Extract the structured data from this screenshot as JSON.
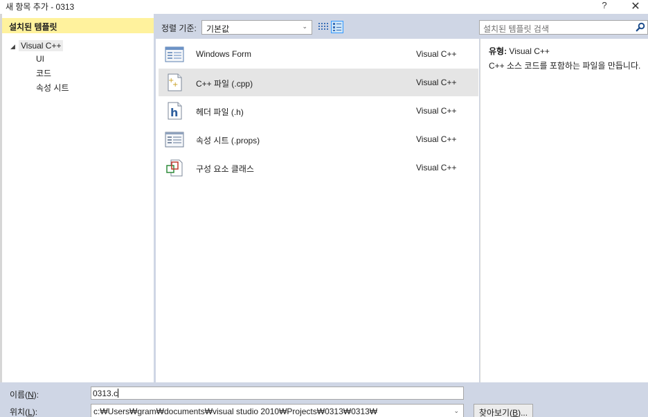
{
  "window": {
    "title": "새 항목 추가 - 0313",
    "help": "?",
    "close": "✕"
  },
  "left": {
    "header": "설치된 템플릿",
    "tree": {
      "root": "Visual C++",
      "children": [
        "UI",
        "코드",
        "속성 시트"
      ]
    }
  },
  "toolbar": {
    "sort_label": "정렬 기준:",
    "sort_value": "기본값",
    "chevron": "⌄"
  },
  "search": {
    "placeholder": "설치된 템플릿 검색"
  },
  "templates": [
    {
      "name": "Windows Form",
      "lang": "Visual C++",
      "icon": "form-icon"
    },
    {
      "name": "C++ 파일 (.cpp)",
      "lang": "Visual C++",
      "icon": "cpp-file-icon",
      "selected": true
    },
    {
      "name": "헤더 파일 (.h)",
      "lang": "Visual C++",
      "icon": "header-file-icon"
    },
    {
      "name": "속성 시트 (.props)",
      "lang": "Visual C++",
      "icon": "property-sheet-icon"
    },
    {
      "name": "구성 요소 클래스",
      "lang": "Visual C++",
      "icon": "component-class-icon"
    }
  ],
  "details": {
    "type_label": "유형:",
    "type_value": "Visual C++",
    "description": "C++ 소스 코드를 포함하는 파일을 만듭니다."
  },
  "bottom": {
    "name_label_pre": "이름(",
    "name_label_key": "N",
    "name_label_post": "):",
    "name_value": "0313.c",
    "location_label_pre": "위치(",
    "location_label_key": "L",
    "location_label_post": "):",
    "location_value": "c:₩Users₩gram₩documents₩visual studio 2010₩Projects₩0313₩0313₩",
    "browse_pre": "찾아보기(",
    "browse_key": "B",
    "browse_post": ")..."
  }
}
